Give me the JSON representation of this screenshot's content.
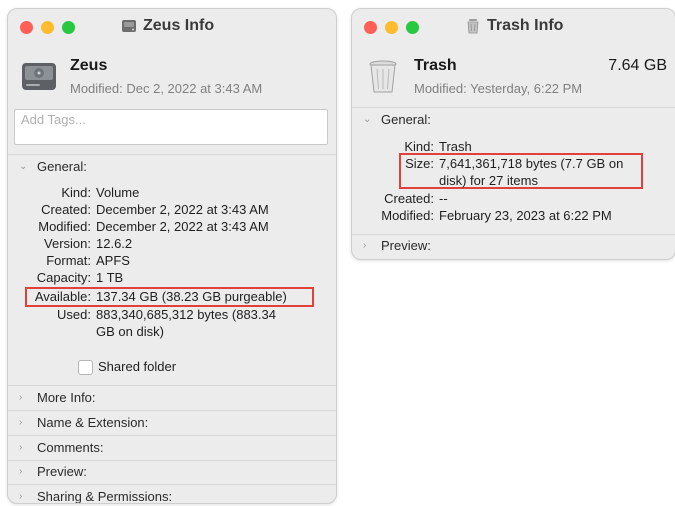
{
  "colors": {
    "close": "#fe5f57",
    "minimize": "#febc2e",
    "zoom": "#28c840",
    "highlight": "#e0413b"
  },
  "zeus": {
    "window_title": "Zeus Info",
    "title_icon": "drive-icon",
    "name": "Zeus",
    "modified": "Modified: Dec 2, 2022 at 3:43 AM",
    "tags_placeholder": "Add Tags...",
    "general_label": "General:",
    "rows": [
      {
        "label": "Kind:",
        "value": "Volume"
      },
      {
        "label": "Created:",
        "value": "December 2, 2022 at 3:43 AM"
      },
      {
        "label": "Modified:",
        "value": "December 2, 2022 at 3:43 AM"
      },
      {
        "label": "Version:",
        "value": "12.6.2"
      },
      {
        "label": "Format:",
        "value": "APFS"
      },
      {
        "label": "Capacity:",
        "value": "1 TB"
      },
      {
        "label": "Available:",
        "value": "137.34 GB (38.23 GB purgeable)"
      },
      {
        "label": "Used:",
        "value1": "883,340,685,312 bytes (883.34",
        "value2": "GB on disk)"
      }
    ],
    "shared_folder_label": "Shared folder",
    "sections": [
      "More Info:",
      "Name & Extension:",
      "Comments:",
      "Preview:",
      "Sharing & Permissions:"
    ]
  },
  "trash": {
    "window_title": "Trash Info",
    "title_icon": "trash-icon",
    "name": "Trash",
    "size": "7.64 GB",
    "modified": "Modified: Yesterday, 6:22 PM",
    "general_label": "General:",
    "rows": [
      {
        "label": "Kind:",
        "value": "Trash"
      },
      {
        "label": "Size:",
        "value1": "7,641,361,718 bytes (7.7 GB on",
        "value2": "disk) for 27 items"
      },
      {
        "label": "Created:",
        "value": "--"
      },
      {
        "label": "Modified:",
        "value": "February 23, 2023 at 6:22 PM"
      }
    ],
    "preview_label": "Preview:"
  }
}
